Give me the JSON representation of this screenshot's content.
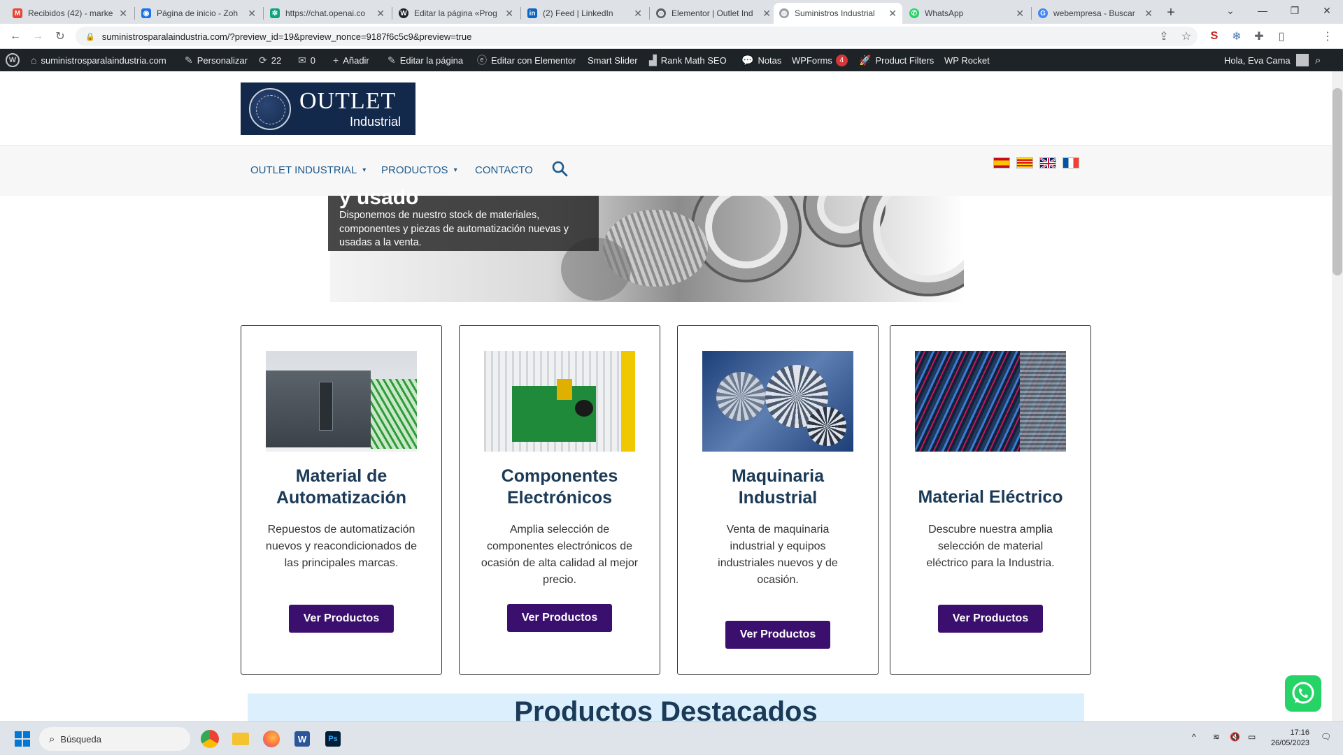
{
  "browser": {
    "tabs": [
      {
        "title": "Recibidos (42) - marke",
        "favicon": "gmail-icon",
        "color": "#ea4335"
      },
      {
        "title": "Página de inicio - Zoh",
        "favicon": "zoho-icon",
        "color": "#1a73e8"
      },
      {
        "title": "https://chat.openai.co",
        "favicon": "openai-icon",
        "color": "#10a37f"
      },
      {
        "title": "Editar la página «Prog",
        "favicon": "wordpress-icon",
        "color": "#1d2327"
      },
      {
        "title": "(2) Feed | LinkedIn",
        "favicon": "linkedin-icon",
        "color": "#0a66c2"
      },
      {
        "title": "Elementor | Outlet Ind",
        "favicon": "globe-icon",
        "color": "#5f6368"
      },
      {
        "title": "Suministros Industrial",
        "favicon": "globe-icon",
        "color": "#9aa0a6"
      },
      {
        "title": "WhatsApp",
        "favicon": "whatsapp-icon",
        "color": "#25d366"
      },
      {
        "title": "webempresa - Buscar",
        "favicon": "google-icon",
        "color": "#4285f4"
      }
    ],
    "active_tab_index": 6,
    "url": "suministrosparalaindustria.com/?preview_id=19&preview_nonce=9187f6c5c9&preview=true",
    "profile_initial": "E"
  },
  "adminbar": {
    "site": "suministrosparalaindustria.com",
    "customize": "Personalizar",
    "updates_count": "22",
    "comments_count": "0",
    "add_new": "Añadir",
    "edit_page": "Editar la página",
    "edit_elementor": "Editar con Elementor",
    "smart_slider": "Smart Slider",
    "rank_math": "Rank Math SEO",
    "notes": "Notas",
    "wpforms": "WPForms",
    "wpforms_badge": "4",
    "product_filters": "Product Filters",
    "wp_rocket": "WP Rocket",
    "greeting": "Hola, Eva Cama"
  },
  "site": {
    "logo_main": "OUTLET",
    "logo_sub": "Industrial",
    "nav": [
      {
        "label": "OUTLET INDUSTRIAL",
        "dropdown": true
      },
      {
        "label": "PRODUCTOS",
        "dropdown": true
      },
      {
        "label": "CONTACTO",
        "dropdown": false
      }
    ],
    "languages": [
      "es",
      "ca",
      "en",
      "fr"
    ],
    "hero": {
      "title": "y usado",
      "text": "Disponemos de nuestro stock de materiales, componentes y piezas de automatización nuevas y usadas a la venta."
    },
    "cards": [
      {
        "title": "Material de Automatización",
        "text": "Repuestos de automatización nuevos y reacondicionados de las principales marcas.",
        "button": "Ver Productos"
      },
      {
        "title": "Componentes Electrónicos",
        "text": "Amplia selección de componentes electrónicos de ocasión de alta calidad al mejor precio.",
        "button": "Ver Productos"
      },
      {
        "title": "Maquinaria Industrial",
        "text": "Venta de maquinaria industrial y equipos industriales nuevos y de ocasión.",
        "button": "Ver Productos"
      },
      {
        "title": "Material Eléctrico",
        "text": "Descubre nuestra amplia selección de material eléctrico para la Industria.",
        "button": "Ver Productos"
      }
    ],
    "featured_title": "Productos Destacados"
  },
  "taskbar": {
    "search_placeholder": "Búsqueda",
    "time": "17:16",
    "date": "26/05/2023"
  },
  "colors": {
    "brand_navy": "#13294b",
    "button_purple": "#3b0f6e",
    "title_blue": "#1b3a57",
    "nav_blue": "#1e5a8c",
    "whatsapp_green": "#25d366"
  }
}
